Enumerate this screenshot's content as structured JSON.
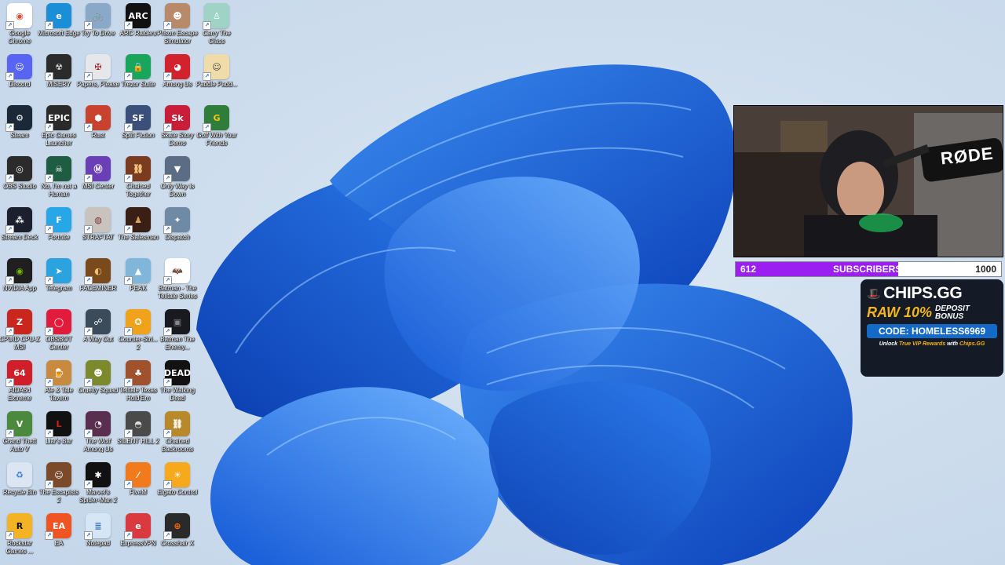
{
  "desktop": {
    "icons": [
      {
        "label": "Google Chrome",
        "icon": "chrome-icon",
        "color": "#ffffff",
        "glyph": "◉",
        "fg": "#dd4b39"
      },
      {
        "label": "Microsoft Edge",
        "icon": "edge-icon",
        "color": "#1b8ed8",
        "glyph": "e",
        "fg": "#ffffff"
      },
      {
        "label": "Try To Drive",
        "icon": "try-to-drive-icon",
        "color": "#8aa9c9",
        "glyph": "🚲",
        "fg": "#ffffff"
      },
      {
        "label": "ARC Raiders",
        "icon": "arc-raiders-icon",
        "color": "#111111",
        "glyph": "ARC",
        "fg": "#ffffff"
      },
      {
        "label": "Prison Escape Simulator",
        "icon": "prison-escape-icon",
        "color": "#b88a6a",
        "glyph": "☻",
        "fg": "#ffffff"
      },
      {
        "label": "Carry The Glass",
        "icon": "carry-the-glass-icon",
        "color": "#9fd3c6",
        "glyph": "♙",
        "fg": "#ffffff"
      },
      {
        "label": "Discord",
        "icon": "discord-icon",
        "color": "#5865f2",
        "glyph": "☺",
        "fg": "#ffffff"
      },
      {
        "label": "MISERY",
        "icon": "misery-icon",
        "color": "#2b2b2b",
        "glyph": "☢",
        "fg": "#dddddd"
      },
      {
        "label": "Papers, Please",
        "icon": "papers-please-icon",
        "color": "#e5e7ea",
        "glyph": "✠",
        "fg": "#9c1c1c"
      },
      {
        "label": "Trezor Suite",
        "icon": "trezor-icon",
        "color": "#17a65b",
        "glyph": "🔒",
        "fg": "#ffffff"
      },
      {
        "label": "Among Us",
        "icon": "among-us-icon",
        "color": "#d2222d",
        "glyph": "◕",
        "fg": "#ffffff"
      },
      {
        "label": "Paddle Padd...",
        "icon": "paddle-icon",
        "color": "#efdca8",
        "glyph": "☺",
        "fg": "#444444"
      },
      {
        "label": "Steam",
        "icon": "steam-icon",
        "color": "#1b2838",
        "glyph": "⚙",
        "fg": "#ffffff"
      },
      {
        "label": "Epic Games Launcher",
        "icon": "epic-games-icon",
        "color": "#2a2a2a",
        "glyph": "EPIC",
        "fg": "#ffffff"
      },
      {
        "label": "Rust",
        "icon": "rust-icon",
        "color": "#c8422e",
        "glyph": "⬢",
        "fg": "#ffffff"
      },
      {
        "label": "Split Fiction",
        "icon": "split-fiction-icon",
        "color": "#3a4f7a",
        "glyph": "SF",
        "fg": "#ffffff"
      },
      {
        "label": "Skate Story Demo",
        "icon": "skate-story-icon",
        "color": "#c81e3a",
        "glyph": "Sk",
        "fg": "#ffffff"
      },
      {
        "label": "Golf With Your Friends",
        "icon": "golf-icon",
        "color": "#2f7d3a",
        "glyph": "G",
        "fg": "#f5c518"
      },
      {
        "label": "OBS Studio",
        "icon": "obs-icon",
        "color": "#2b2b2b",
        "glyph": "◎",
        "fg": "#ffffff"
      },
      {
        "label": "No, I'm not a Human",
        "icon": "not-human-icon",
        "color": "#1f5c44",
        "glyph": "☠",
        "fg": "#ffffff"
      },
      {
        "label": "MSI Center",
        "icon": "msi-center-icon",
        "color": "#6a3fb5",
        "glyph": "Ⓜ",
        "fg": "#ffffff"
      },
      {
        "label": "Chained Together",
        "icon": "chained-together-icon",
        "color": "#7a3b1f",
        "glyph": "⛓",
        "fg": "#ffd28a"
      },
      {
        "label": "Only Way Is Down",
        "icon": "only-way-down-icon",
        "color": "#5b6c85",
        "glyph": "▼",
        "fg": "#ffffff"
      },
      {
        "label": "",
        "icon": "",
        "color": "",
        "glyph": "",
        "fg": ""
      },
      {
        "label": "Stream Deck",
        "icon": "stream-deck-icon",
        "color": "#1c1f2e",
        "glyph": "⁂",
        "fg": "#ffffff"
      },
      {
        "label": "Fortnite",
        "icon": "fortnite-icon",
        "color": "#27a7e8",
        "glyph": "F",
        "fg": "#ffffff"
      },
      {
        "label": "STRAFTAT",
        "icon": "straftat-icon",
        "color": "#c9c3bd",
        "glyph": "◍",
        "fg": "#7a2c2c"
      },
      {
        "label": "The Salesman",
        "icon": "salesman-icon",
        "color": "#3a1f14",
        "glyph": "♟",
        "fg": "#e0a060"
      },
      {
        "label": "Dispatch",
        "icon": "dispatch-icon",
        "color": "#6f8aa5",
        "glyph": "✦",
        "fg": "#ffffff"
      },
      {
        "label": "",
        "icon": "",
        "color": "",
        "glyph": "",
        "fg": ""
      },
      {
        "label": "NVIDIA App",
        "icon": "nvidia-icon",
        "color": "#1f1f1f",
        "glyph": "◉",
        "fg": "#76b900"
      },
      {
        "label": "Telegram",
        "icon": "telegram-icon",
        "color": "#2aa3df",
        "glyph": "➤",
        "fg": "#ffffff"
      },
      {
        "label": "FACEMINER",
        "icon": "faceminer-icon",
        "color": "#7a4a1c",
        "glyph": "◐",
        "fg": "#f0c070"
      },
      {
        "label": "PEAK",
        "icon": "peak-icon",
        "color": "#7fb6d9",
        "glyph": "▲",
        "fg": "#ffffff"
      },
      {
        "label": "Batman - The Telltale Series",
        "icon": "batman-telltale-icon",
        "color": "#ffffff",
        "glyph": "🦇",
        "fg": "#111111"
      },
      {
        "label": "",
        "icon": "",
        "color": "",
        "glyph": "",
        "fg": ""
      },
      {
        "label": "CPUID CPU-Z MSI",
        "icon": "cpu-z-icon",
        "color": "#c9261e",
        "glyph": "Z",
        "fg": "#ffffff"
      },
      {
        "label": "OBSBOT Center",
        "icon": "obsbot-icon",
        "color": "#e21b3c",
        "glyph": "◯",
        "fg": "#ffffff"
      },
      {
        "label": "A Way Out",
        "icon": "a-way-out-icon",
        "color": "#3c4b5a",
        "glyph": "☍",
        "fg": "#ffffff"
      },
      {
        "label": "Counter-Stri... 2",
        "icon": "counter-strike-icon",
        "color": "#f0a21a",
        "glyph": "✪",
        "fg": "#ffffff"
      },
      {
        "label": "Batman The Enemy...",
        "icon": "batman-enemy-icon",
        "color": "#181a1f",
        "glyph": "▣",
        "fg": "#888888"
      },
      {
        "label": "",
        "icon": "",
        "color": "",
        "glyph": "",
        "fg": ""
      },
      {
        "label": "AIDA64 Extreme",
        "icon": "aida64-icon",
        "color": "#d01f28",
        "glyph": "64",
        "fg": "#ffffff"
      },
      {
        "label": "Ale & Tale Tavern",
        "icon": "ale-tale-icon",
        "color": "#c88a3e",
        "glyph": "🍺",
        "fg": "#ffffff"
      },
      {
        "label": "Cruelty Squad",
        "icon": "cruelty-squad-icon",
        "color": "#7d8a2c",
        "glyph": "☻",
        "fg": "#ffffff"
      },
      {
        "label": "Telltale Texas Hold'Em",
        "icon": "telltale-texas-icon",
        "color": "#a0522d",
        "glyph": "♣",
        "fg": "#ffffff"
      },
      {
        "label": "The Walking Dead",
        "icon": "walking-dead-icon",
        "color": "#121212",
        "glyph": "DEAD",
        "fg": "#ffffff"
      },
      {
        "label": "",
        "icon": "",
        "color": "",
        "glyph": "",
        "fg": ""
      },
      {
        "label": "Grand Theft Auto V",
        "icon": "gta-v-icon",
        "color": "#4b8a3c",
        "glyph": "V",
        "fg": "#ffffff"
      },
      {
        "label": "Liar's Bar",
        "icon": "liars-bar-icon",
        "color": "#111111",
        "glyph": "L",
        "fg": "#d21f1f"
      },
      {
        "label": "The Wolf Among Us",
        "icon": "wolf-among-us-icon",
        "color": "#5a2e4e",
        "glyph": "◔",
        "fg": "#ffffff"
      },
      {
        "label": "SILENT HILL 2",
        "icon": "silent-hill-icon",
        "color": "#4a4a4a",
        "glyph": "◓",
        "fg": "#dddddd"
      },
      {
        "label": "Chained Backrooms",
        "icon": "chained-backrooms-icon",
        "color": "#b8892a",
        "glyph": "⛓",
        "fg": "#ffffff"
      },
      {
        "label": "",
        "icon": "",
        "color": "",
        "glyph": "",
        "fg": ""
      },
      {
        "label": "Recycle Bin",
        "icon": "recycle-bin-icon",
        "color": "#dbe6f2",
        "glyph": "♻",
        "fg": "#3a7bd5"
      },
      {
        "label": "The Escapists 2",
        "icon": "escapists-icon",
        "color": "#7a4a2a",
        "glyph": "☺",
        "fg": "#ffffff"
      },
      {
        "label": "Marvel's Spider-Man 2",
        "icon": "spider-man-icon",
        "color": "#111111",
        "glyph": "✱",
        "fg": "#ffffff"
      },
      {
        "label": "FiveM",
        "icon": "fivem-icon",
        "color": "#f07a1c",
        "glyph": "⁄",
        "fg": "#ffffff"
      },
      {
        "label": "Elgato Control",
        "icon": "elgato-control-icon",
        "color": "#f6a91c",
        "glyph": "☀",
        "fg": "#ffffff"
      },
      {
        "label": "",
        "icon": "",
        "color": "",
        "glyph": "",
        "fg": ""
      },
      {
        "label": "Rockstar Games ...",
        "icon": "rockstar-icon",
        "color": "#f4b324",
        "glyph": "R",
        "fg": "#111111"
      },
      {
        "label": "EA",
        "icon": "ea-icon",
        "color": "#f05423",
        "glyph": "EA",
        "fg": "#ffffff"
      },
      {
        "label": "Notepad",
        "icon": "notepad-icon",
        "color": "#d7e6f7",
        "glyph": "≣",
        "fg": "#2e6bbf"
      },
      {
        "label": "ExpressVPN",
        "icon": "expressvpn-icon",
        "color": "#da3940",
        "glyph": "e",
        "fg": "#ffffff"
      },
      {
        "label": "Crosshair X",
        "icon": "crosshair-icon",
        "color": "#2a2a2a",
        "glyph": "⊕",
        "fg": "#ff6a00"
      }
    ]
  },
  "overlay": {
    "webcam": {
      "mic_brand": "RØDE"
    },
    "subscribers": {
      "current": 612,
      "goal": 1000,
      "current_text": "612",
      "goal_text": "1000",
      "label": "SUBSCRIBERS",
      "bar_color": "#9b1ff0"
    },
    "ad": {
      "brand": "CHIPS.GG",
      "raw": "RAW 10%",
      "deposit_line1": "DEPOSIT",
      "deposit_line2": "BONUS",
      "code": "CODE: HOMELESS6969",
      "sub_prefix": "Unlock ",
      "sub_highlight1": "True VIP Rewards",
      "sub_middle": " with ",
      "sub_highlight2": "Chips.GG"
    }
  }
}
